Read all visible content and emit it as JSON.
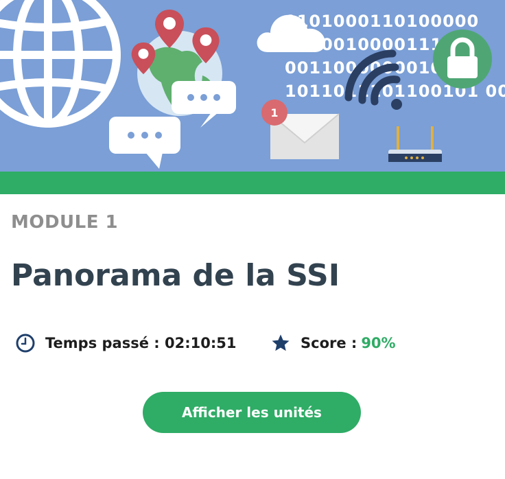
{
  "banner": {
    "binary_lines": [
      "0101000110100000",
      "01100100001111",
      "0011000000010",
      "1011011101100101 00"
    ],
    "notification_count": "1",
    "colors": {
      "background": "#7b9fd6",
      "bar": "#2fac66",
      "lock": "#4fa674",
      "pin": "#c94f5a"
    },
    "icons": [
      "globe-icon",
      "earth-icon",
      "map-pin-icon",
      "chat-bubble-icon",
      "cloud-icon",
      "envelope-icon",
      "wifi-icon",
      "lock-icon",
      "router-icon"
    ]
  },
  "module": {
    "label": "MODULE 1",
    "title": "Panorama de la SSI"
  },
  "stats": {
    "time_label": "Temps passé : 02:10:51",
    "score_label": "Score :",
    "score_value": "90%"
  },
  "actions": {
    "show_units_label": "Afficher les unités"
  },
  "colors": {
    "accent": "#2fac66",
    "title": "#32424f",
    "muted": "#8e8e8e",
    "icon": "#1f3f6b"
  }
}
